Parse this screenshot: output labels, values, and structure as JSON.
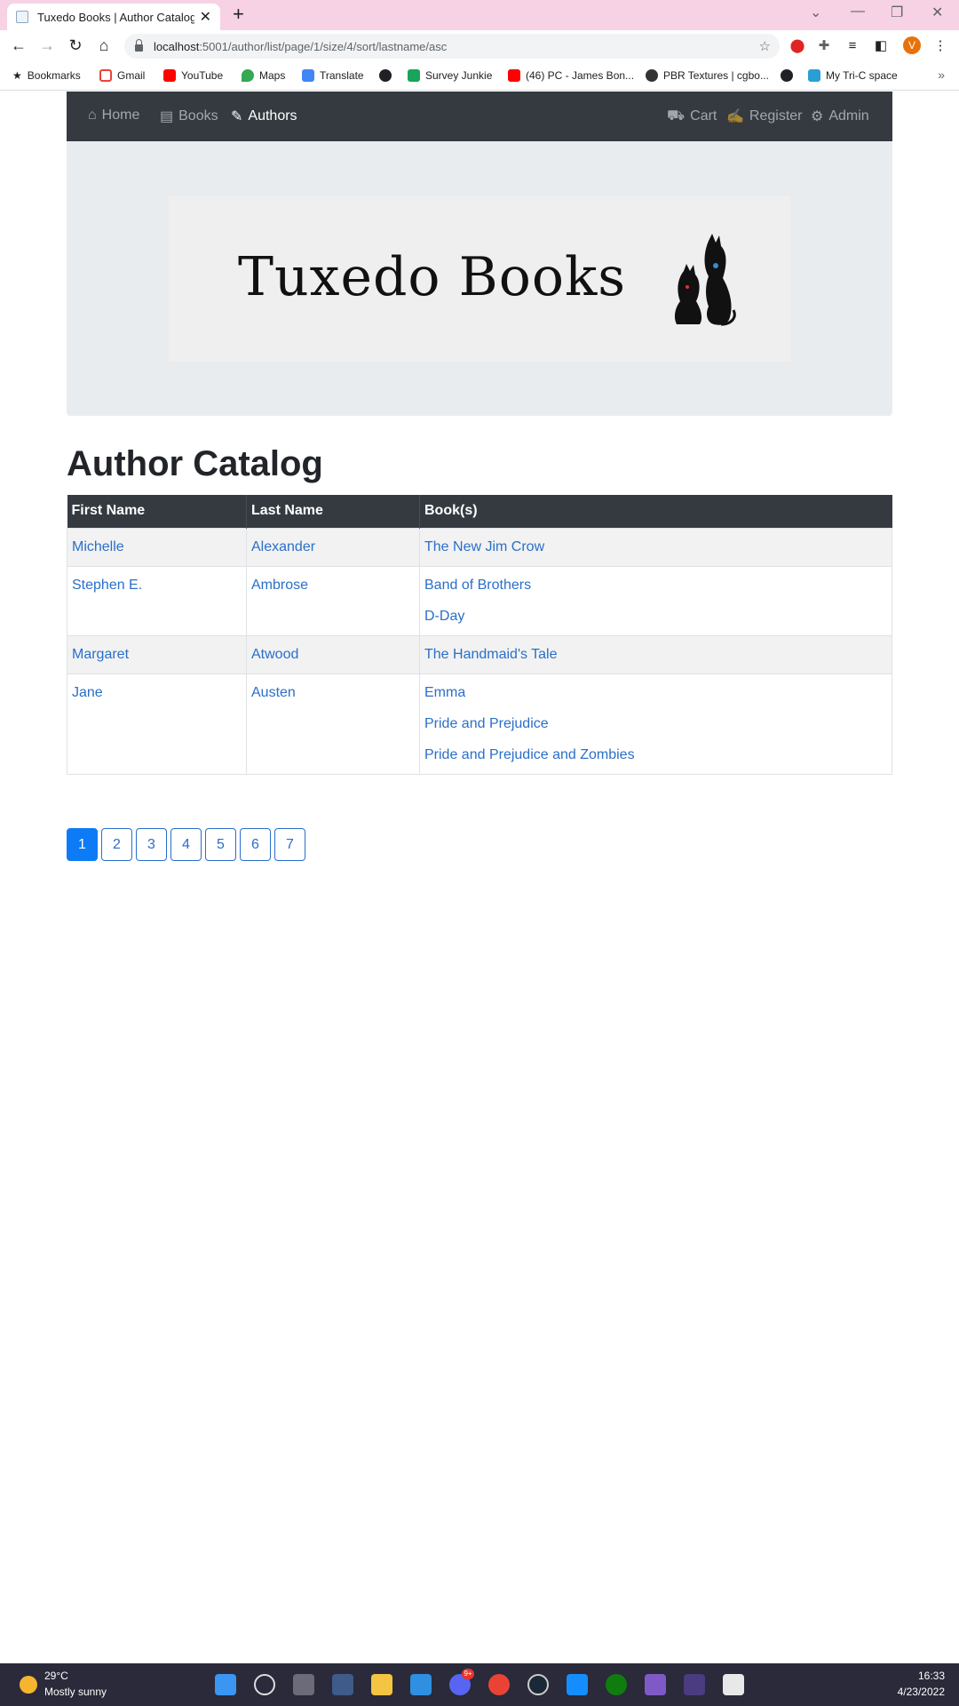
{
  "browser": {
    "tab_title": "Tuxedo Books | Author Catalog",
    "url_host": "localhost",
    "url_path": ":5001/author/list/page/1/size/4/sort/lastname/asc",
    "avatar_letter": "V"
  },
  "bookmarks": [
    {
      "label": "Bookmarks",
      "color": "#202124"
    },
    {
      "label": "Gmail",
      "color": "#ea4335"
    },
    {
      "label": "YouTube",
      "color": "#ff0000"
    },
    {
      "label": "Maps",
      "color": "#34a853"
    },
    {
      "label": "Translate",
      "color": "#4285f4"
    },
    {
      "label": "",
      "color": "#202124"
    },
    {
      "label": "Survey Junkie",
      "color": "#1aa35a"
    },
    {
      "label": "(46) PC - James Bon...",
      "color": "#ff0000"
    },
    {
      "label": "PBR Textures | cgbo...",
      "color": "#333333"
    },
    {
      "label": "",
      "color": "#202124"
    },
    {
      "label": "My Tri-C space",
      "color": "#2a9fd6"
    }
  ],
  "site_nav": {
    "home": "Home",
    "books": "Books",
    "authors": "Authors",
    "cart": "Cart",
    "register": "Register",
    "admin": "Admin"
  },
  "logo": {
    "text": "Tuxedo Books"
  },
  "page": {
    "title": "Author Catalog"
  },
  "table": {
    "headers": [
      "First Name",
      "Last Name",
      "Book(s)"
    ],
    "rows": [
      {
        "first": "Michelle",
        "last": "Alexander",
        "books": [
          "The New Jim Crow"
        ]
      },
      {
        "first": "Stephen E.",
        "last": "Ambrose",
        "books": [
          "Band of Brothers",
          "D-Day"
        ]
      },
      {
        "first": "Margaret",
        "last": "Atwood",
        "books": [
          "The Handmaid's Tale"
        ]
      },
      {
        "first": "Jane",
        "last": "Austen",
        "books": [
          "Emma",
          "Pride and Prejudice",
          "Pride and Prejudice and Zombies"
        ]
      }
    ]
  },
  "pagination": {
    "pages": [
      "1",
      "2",
      "3",
      "4",
      "5",
      "6",
      "7"
    ],
    "current": "1"
  },
  "taskbar": {
    "temp": "29°C",
    "weather": "Mostly sunny",
    "time": "16:33",
    "date": "4/23/2022",
    "badge": "9+"
  },
  "colors": {
    "navbar": "#343a40",
    "link": "#2a6fc9",
    "active_page": "#0d7bf5",
    "tab_strip": "#f6d2e4"
  }
}
